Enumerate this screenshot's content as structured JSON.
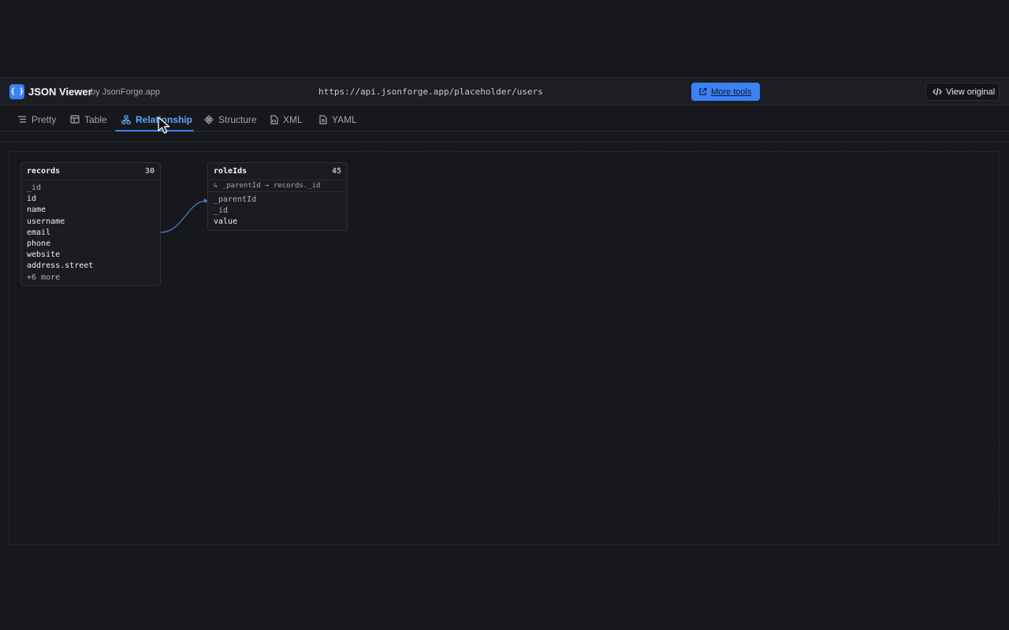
{
  "header": {
    "logo_text": "{ }",
    "title": "JSON Viewer",
    "by": "by JsonForge.app",
    "url": "https://api.jsonforge.app/placeholder/users",
    "more_tools": "More tools",
    "view_original": "View original"
  },
  "tabs": [
    {
      "label": "Pretty",
      "icon": "list-icon"
    },
    {
      "label": "Table",
      "icon": "table-icon"
    },
    {
      "label": "Relationship",
      "icon": "relationship-icon",
      "active": true
    },
    {
      "label": "Structure",
      "icon": "structure-icon"
    },
    {
      "label": "XML",
      "icon": "code-file-icon"
    },
    {
      "label": "YAML",
      "icon": "document-icon"
    }
  ],
  "nodes": {
    "records": {
      "title": "records",
      "count": "30",
      "fields": [
        "_id",
        "id",
        "name",
        "username",
        "email",
        "phone",
        "website",
        "address.street"
      ],
      "more": "+6 more"
    },
    "roleIds": {
      "title": "roleIds",
      "count": "45",
      "relation": "↳ _parentId → records._id",
      "fields": [
        "_parentId",
        "_id",
        "value"
      ]
    }
  },
  "colors": {
    "accent": "#3b82f6",
    "background": "#17181c",
    "edge": "#4f76c9"
  }
}
